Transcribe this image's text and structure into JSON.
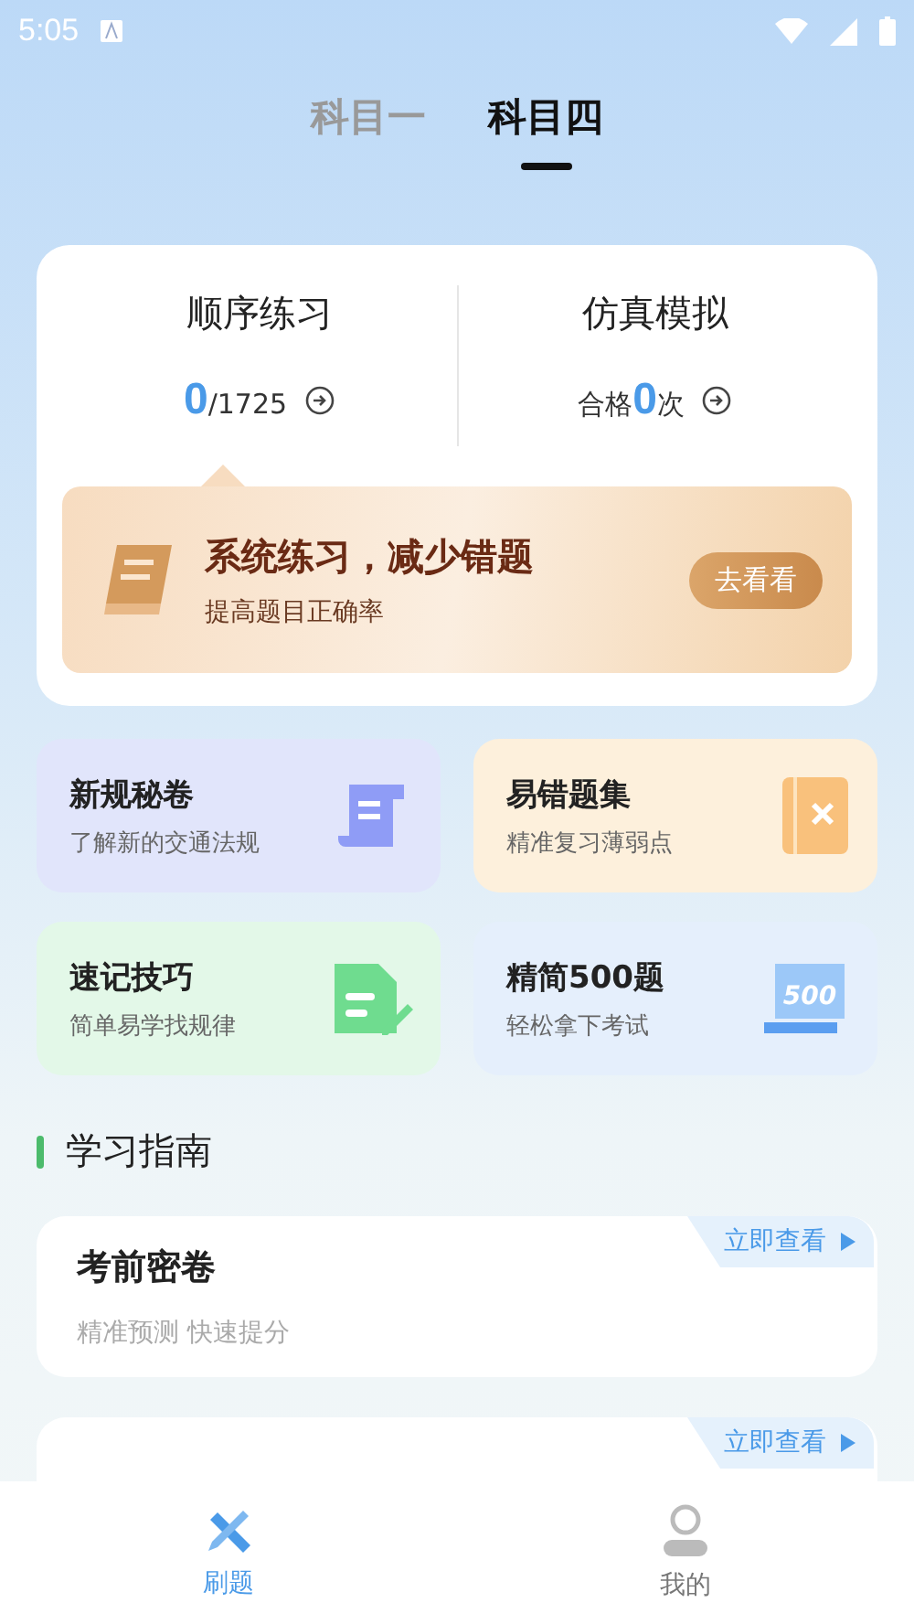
{
  "status_bar": {
    "time": "5:05"
  },
  "tabs": [
    {
      "label": "科目一",
      "selected": false
    },
    {
      "label": "科目四",
      "selected": true
    }
  ],
  "practice": [
    {
      "title": "顺序练习",
      "count": "0",
      "suffix": "/1725"
    },
    {
      "title": "仿真模拟",
      "prefix": "合格",
      "count": "0",
      "suffix": "次"
    }
  ],
  "promo": {
    "title": "系统练习，减少错题",
    "subtitle": "提高题目正确率",
    "button": "去看看"
  },
  "features": [
    {
      "kind": "scroll",
      "title": "新规秘卷",
      "subtitle": "了解新的交通法规"
    },
    {
      "kind": "wrong",
      "title": "易错题集",
      "subtitle": "精准复习薄弱点"
    },
    {
      "kind": "note",
      "title": "速记技巧",
      "subtitle": "简单易学找规律"
    },
    {
      "kind": "five",
      "title": "精简500题",
      "subtitle": "轻松拿下考试",
      "icon_text": "500"
    }
  ],
  "guide": {
    "heading": "学习指南",
    "items": [
      {
        "title": "考前密卷",
        "subtitle": "精准预测 快速提分",
        "action": "立即查看"
      },
      {
        "action": "立即查看"
      }
    ]
  },
  "nav": [
    {
      "kind": "practice",
      "label": "刷题",
      "selected": true
    },
    {
      "kind": "me",
      "label": "我的",
      "selected": false
    }
  ]
}
